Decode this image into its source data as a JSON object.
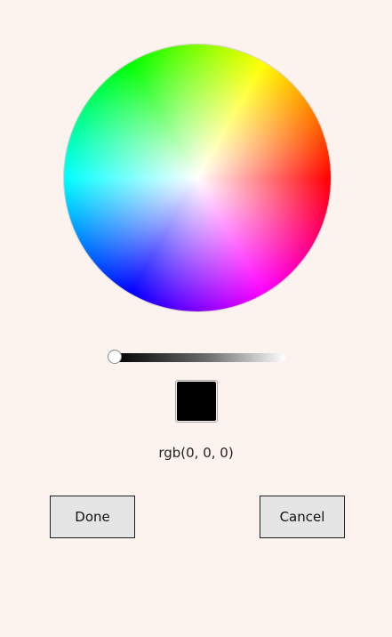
{
  "picker": {
    "color_wheel": {
      "hues": [
        "#ff0000",
        "#ff00ff",
        "#0000ff",
        "#00ffff",
        "#00ff00",
        "#ffff00"
      ]
    },
    "brightness_slider": {
      "value": 0,
      "gradient_start": "#000000",
      "gradient_end": "#ffffff"
    },
    "selected_color": {
      "hex": "#000000",
      "rgb_text": "rgb(0, 0, 0)"
    }
  },
  "actions": {
    "done_label": "Done",
    "cancel_label": "Cancel"
  },
  "colors": {
    "background": "#fdf3ee",
    "button_fill": "#e6e5e6",
    "button_border": "#1f1f1f"
  }
}
